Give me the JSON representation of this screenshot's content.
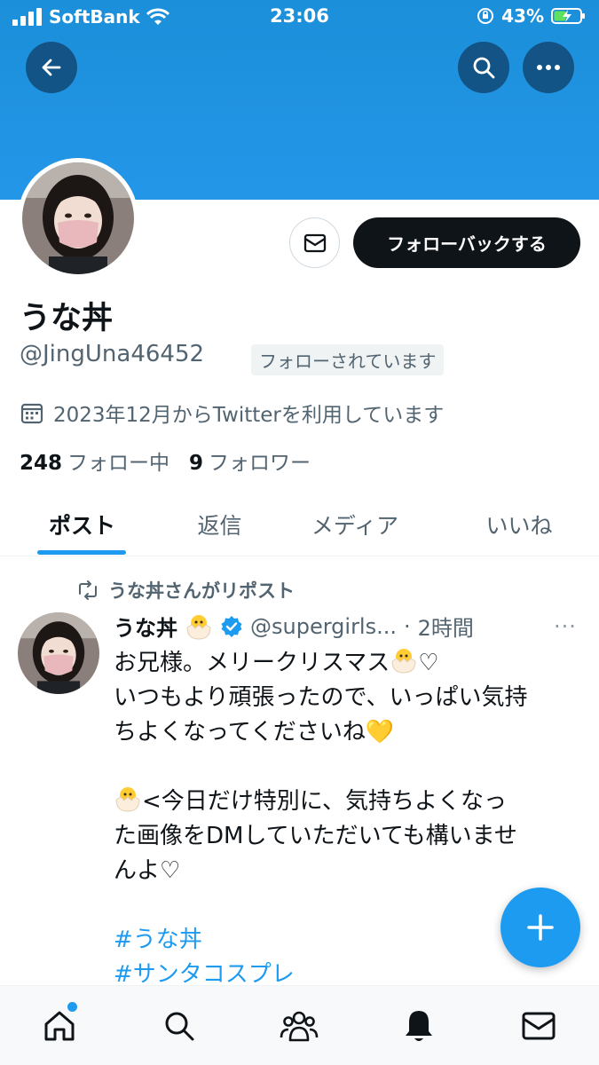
{
  "status_bar": {
    "carrier": "SoftBank",
    "time": "23:06",
    "battery": "43%"
  },
  "profile": {
    "display_name": "うな丼",
    "handle": "@JingUna46452",
    "follows_you_label": "フォローされています",
    "follow_back_label": "フォローバックする",
    "joined": "2023年12月からTwitterを利用しています",
    "following_count": "248",
    "following_label": "フォロー中",
    "followers_count": "9",
    "followers_label": "フォロワー"
  },
  "tabs": [
    {
      "label": "ポスト",
      "active": true
    },
    {
      "label": "返信",
      "active": false
    },
    {
      "label": "メディア",
      "active": false
    },
    {
      "label": "いいね",
      "active": false
    }
  ],
  "tweet": {
    "repost_label": "うな丼さんがリポスト",
    "author_name": "うな丼",
    "author_handle": "@supergirls...",
    "separator": "·",
    "time_ago": "2時間",
    "more": "···",
    "line1": "お兄様。メリークリスマス",
    "line1_tail": "♡",
    "line2": "いつもより頑張ったので、いっぱい気持",
    "line3": "ちよくなってくださいね",
    "line3_tail": "💛",
    "line5": "<今日だけ特別に、気持ちよくなっ",
    "line6": "た画像をDMしていただいても構いませ",
    "line7": "んよ♡",
    "hashtag1": "#うな丼",
    "hashtag2": "#サンタコスプレ"
  },
  "colors": {
    "banner": "#1d96e6",
    "accent": "#1d9bf0",
    "text_primary": "#0f1419",
    "text_secondary": "#536471"
  }
}
